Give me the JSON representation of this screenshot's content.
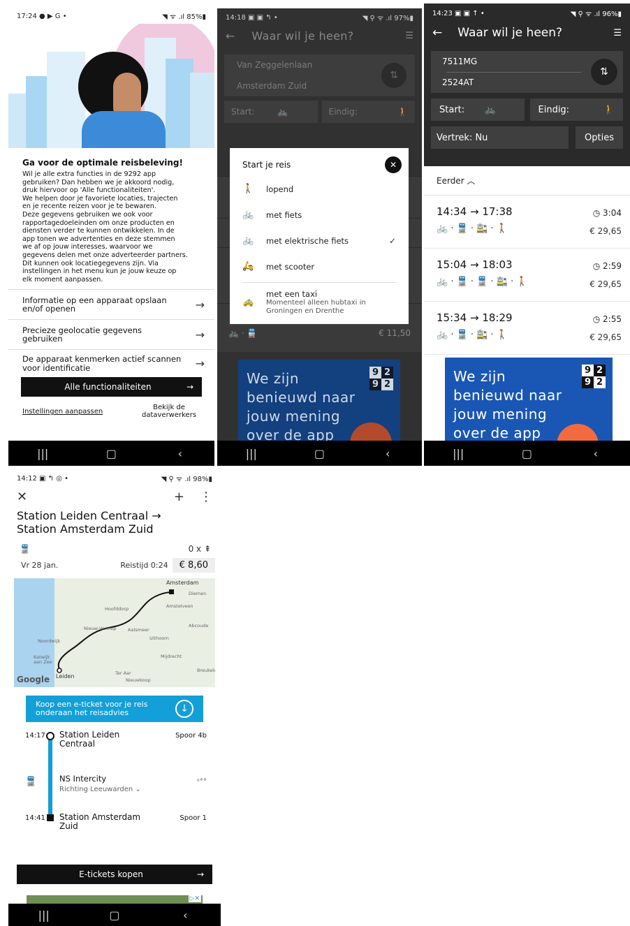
{
  "screen1": {
    "status": {
      "time": "17:24",
      "icons_left": "● ▶ G •",
      "icons_right": "◥ ᯤ .ıl 85%▮"
    },
    "title": "Ga voor de optimale reisbeleving!",
    "body": "Wil je alle extra functies in de 9292 app\ngebruiken? Dan hebben we je akkoord nodig,\ndruk hiervoor op 'Alle functionaliteiten'.\nWe helpen door je favoriete locaties, trajecten\nen je recente reizen voor je te bewaren.\nDeze gegevens gebruiken we ook voor\nrapportagedoeleinden om onze producten en\ndiensten verder te kunnen ontwikkelen. In de\napp tonen we advertenties en deze stemmen\nwe af op jouw interesses, waarvoor we\ngegevens delen met onze adverteerder partners.\nDit kunnen ook locatiegegevens zijn. Via\ninstellingen in het menu kun je jouw keuze op\nelk moment aanpassen.",
    "options": [
      {
        "label": "Informatie op een apparaat opslaan en/of openen"
      },
      {
        "label": "Precieze geolocatie gegevens gebruiken"
      },
      {
        "label": "De apparaat kenmerken actief scannen voor identificatie"
      }
    ],
    "accept_all": "Alle functionaliteiten",
    "settings_link": "Instellingen aanpassen",
    "processors_link": "Bekijk de dataverwerkers"
  },
  "screen2": {
    "status": {
      "time": "14:18",
      "icons_left": "▣ ▣ ↰ •",
      "icons_right": "◥ ⚲ ᯤ .ıl 97%▮"
    },
    "title": "Waar wil je heen?",
    "from": "Van Zeggelenlaan",
    "to": "Amsterdam Zuid",
    "start_label": "Start:",
    "end_label": "Eindig:",
    "modal": {
      "title": "Start je reis",
      "items": [
        {
          "icon": "walk-icon",
          "glyph": "🚶",
          "label": "lopend",
          "checked": false
        },
        {
          "icon": "bike-icon",
          "glyph": "🚲",
          "label": "met fiets",
          "checked": false
        },
        {
          "icon": "ebike-icon",
          "glyph": "🚲",
          "label": "met elektrische fiets",
          "checked": true
        },
        {
          "icon": "scooter-icon",
          "glyph": "🛵",
          "label": "met scooter",
          "checked": false
        }
      ],
      "taxi": {
        "label": "met een taxi",
        "sub": "Momenteel alleen hubtaxi in Groningen en Drenthe"
      }
    },
    "row_price": "€ 11,50",
    "ad": {
      "text": "We zijn benieuwd naar jouw mening over de app",
      "logo": [
        "9",
        "2",
        "9",
        "2"
      ]
    }
  },
  "screen3": {
    "status": {
      "time": "14:23",
      "icons_left": "▣ ▣ ↑ •",
      "icons_right": "◥ ⚲ ᯤ .ıl 96%▮"
    },
    "title": "Waar wil je heen?",
    "from": "7511MG",
    "to": "2524AT",
    "start_label": "Start:",
    "end_label": "Eindig:",
    "departure_label": "Vertrek:",
    "departure_value": "Nu",
    "options_label": "Opties",
    "earlier_label": "Eerder",
    "trips": [
      {
        "time": "14:34 → 17:38",
        "duration": "3:04",
        "price": "€ 29,65",
        "legs": "🚲 · 🚆 · 🚉 · 🚶"
      },
      {
        "time": "15:04 → 18:03",
        "duration": "2:59",
        "price": "€ 29,65",
        "legs": "🚲 · 🚆 · 🚆 · 🚉 · 🚶"
      },
      {
        "time": "15:34 → 18:29",
        "duration": "2:55",
        "price": "€ 29,65",
        "legs": "🚲 · 🚆 · 🚉 · 🚶"
      }
    ],
    "ad": {
      "text": "We zijn benieuwd naar jouw mening over de app",
      "logo": [
        "9",
        "2",
        "9",
        "2"
      ]
    }
  },
  "screen4": {
    "status": {
      "time": "14:12",
      "icons_left": "▣ ↰ ◎ •",
      "icons_right": "◥ ⚲ ᯤ .ıl 98%▮"
    },
    "title": "Station Leiden Centraal →\nStation Amsterdam Zuid",
    "transfers": "0 x ⇞",
    "date": "Vr 28 jan.",
    "travel_time": "Reistijd 0:24",
    "price": "€ 8,60",
    "map_labels": [
      "Amsterdam",
      "Diemen",
      "Hoofddorp",
      "Amstelveen",
      "Nieuw-Vennep",
      "Aalsmeer",
      "Abcoude",
      "Noordwijk",
      "Uithoorn",
      "Katwijk aan Zee",
      "Mijdrecht",
      "Leiden",
      "Ter Aar",
      "Nieuwkoop",
      "Breukelen"
    ],
    "map_brand": "Google",
    "banner": "Koop een e-ticket voor je reis onderaan het reisadvies",
    "departure": {
      "time": "14:17",
      "station": "Station Leiden Centraal",
      "platform": "Spoor 4b"
    },
    "service": {
      "name": "NS Intercity",
      "direction": "Richting Leeuwarden ⌄",
      "occupancy": "ᵒ°°"
    },
    "arrival": {
      "time": "14:41",
      "station": "Station Amsterdam Zuid",
      "platform": "Spoor 1"
    },
    "buy_button": "E-tickets kopen"
  },
  "nav": {
    "recent": "|||",
    "home": "▢",
    "back": "‹"
  }
}
